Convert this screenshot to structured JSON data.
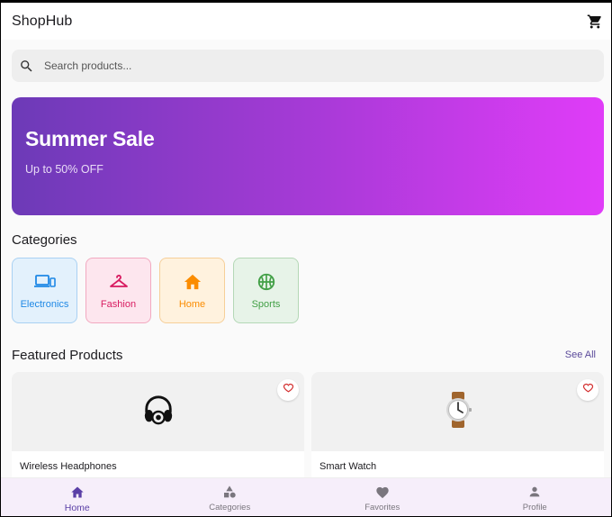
{
  "app": {
    "title": "ShopHub"
  },
  "search": {
    "placeholder": "Search products..."
  },
  "banner": {
    "title": "Summer Sale",
    "subtitle": "Up to 50% OFF"
  },
  "categories": {
    "title": "Categories",
    "items": [
      {
        "label": "Electronics",
        "icon": "devices-icon",
        "color": "#1e88e5"
      },
      {
        "label": "Fashion",
        "icon": "hanger-icon",
        "color": "#d81b60"
      },
      {
        "label": "Home",
        "icon": "home-icon",
        "color": "#fb8c00"
      },
      {
        "label": "Sports",
        "icon": "basketball-icon",
        "color": "#43a047"
      }
    ]
  },
  "featured": {
    "title": "Featured Products",
    "see_all": "See All",
    "products": [
      {
        "name": "Wireless Headphones",
        "icon": "headphones-icon"
      },
      {
        "name": "Smart Watch",
        "icon": "watch-icon"
      }
    ]
  },
  "nav": {
    "items": [
      {
        "label": "Home",
        "icon": "home-icon",
        "active": true
      },
      {
        "label": "Categories",
        "icon": "categories-icon",
        "active": false
      },
      {
        "label": "Favorites",
        "icon": "heart-icon",
        "active": false
      },
      {
        "label": "Profile",
        "icon": "person-icon",
        "active": false
      }
    ]
  },
  "colors": {
    "accent": "#5a3fa6",
    "banner_start": "#6c3ab7",
    "banner_end": "#e03cf8"
  }
}
